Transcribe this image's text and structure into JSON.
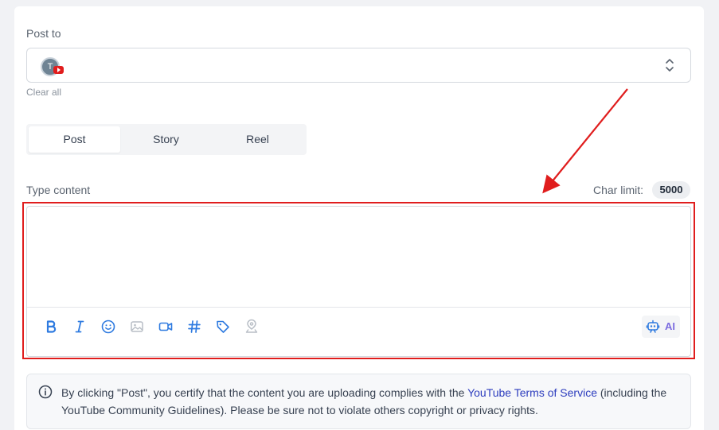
{
  "post_to": {
    "label": "Post to",
    "selected_account_initial": "T",
    "clear_all": "Clear all"
  },
  "tabs": [
    {
      "label": "Post",
      "active": true
    },
    {
      "label": "Story",
      "active": false
    },
    {
      "label": "Reel",
      "active": false
    }
  ],
  "content": {
    "label": "Type content",
    "value": "",
    "char_limit_label": "Char limit:",
    "char_limit_value": "5000"
  },
  "toolbar": {
    "tools": [
      "bold-icon",
      "italic-icon",
      "emoji-icon",
      "image-icon",
      "video-icon",
      "hashtag-icon",
      "tag-icon",
      "location-icon"
    ],
    "ai_label": "AI"
  },
  "notice": {
    "text_before": "By clicking \"Post\", you certify that the content you are uploading complies with the ",
    "link_text": "YouTube Terms of Service",
    "text_after": " (including the YouTube Community Guidelines). Please be sure not to violate others copyright or privacy rights."
  },
  "colors": {
    "accent_blue": "#2f7be0",
    "disabled_icon": "#b8bec6",
    "highlight_red": "#e01d1d",
    "ai_purple": "#7c6ce0",
    "link": "#2d3dbe"
  }
}
